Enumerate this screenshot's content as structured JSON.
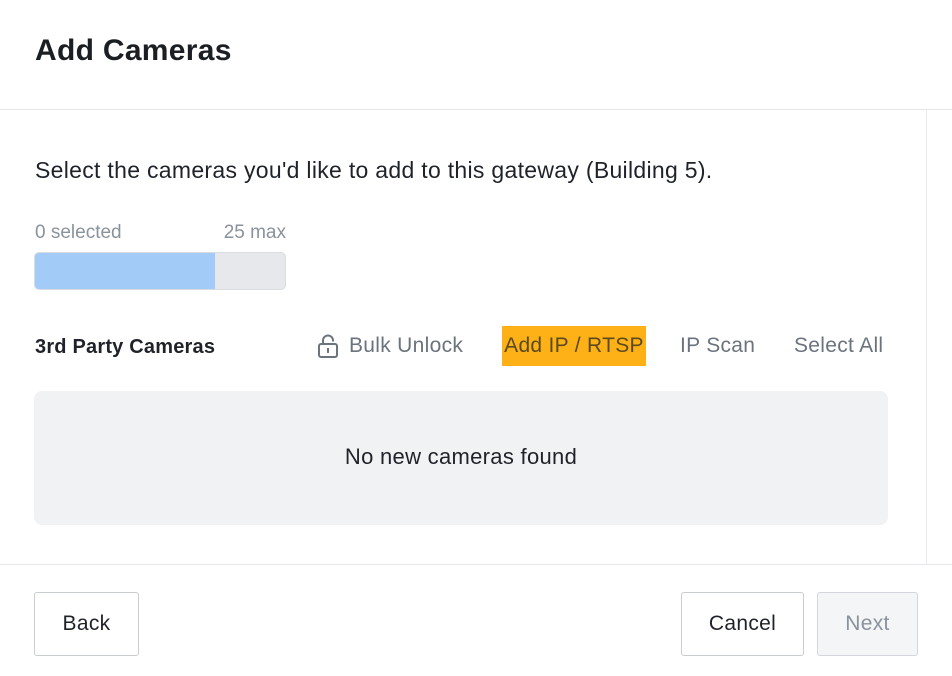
{
  "header": {
    "title": "Add Cameras"
  },
  "intro": {
    "text": "Select the cameras you'd like to add to this gateway (Building 5)."
  },
  "selection": {
    "selected_label": "0 selected",
    "max_label": "25 max",
    "progress_fraction": 0.72
  },
  "section": {
    "label": "3rd Party Cameras",
    "actions": {
      "bulk_unlock": "Bulk Unlock",
      "add_ip": "Add IP / RTSP",
      "ip_scan": "IP Scan",
      "select_all": "Select All"
    }
  },
  "empty_state": {
    "text": "No new cameras found"
  },
  "footer": {
    "back_label": "Back",
    "cancel_label": "Cancel",
    "next_label": "Next"
  },
  "colors": {
    "highlight": "#fdb117",
    "progress_fill": "#a3cbf7",
    "progress_track": "#e6e8eb"
  },
  "icons": {
    "bulk_unlock": "lock-icon"
  }
}
